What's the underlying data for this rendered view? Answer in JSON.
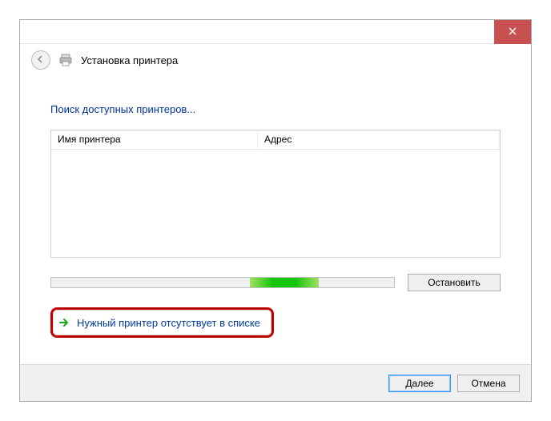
{
  "header": {
    "title": "Установка принтера"
  },
  "main": {
    "subtitle": "Поиск доступных принтеров...",
    "columns": {
      "name": "Имя принтера",
      "address": "Адрес"
    },
    "stop": "Остановить",
    "missing_link": "Нужный принтер отсутствует в списке"
  },
  "footer": {
    "next": "Далее",
    "cancel": "Отмена"
  }
}
